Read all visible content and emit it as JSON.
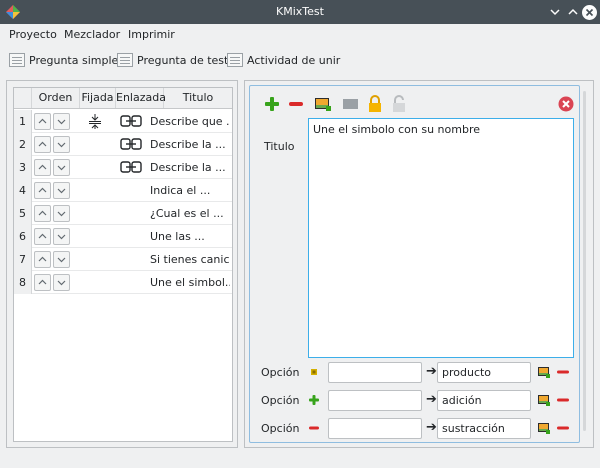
{
  "window": {
    "title": "KMixTest"
  },
  "menu": [
    "Proyecto",
    "Mezclador",
    "Imprimir"
  ],
  "toolbar": [
    {
      "label": "Pregunta simple",
      "icon": "simple-question-icon"
    },
    {
      "label": "Pregunta de test",
      "icon": "test-question-icon"
    },
    {
      "label": "Actividad de unir",
      "icon": "join-activity-icon"
    }
  ],
  "table": {
    "headers": [
      "Orden",
      "Fijada",
      "Enlazada",
      "Titulo"
    ],
    "rows": [
      {
        "num": "1",
        "fixed": true,
        "linked": true,
        "title": "Describe que ..."
      },
      {
        "num": "2",
        "fixed": false,
        "linked": true,
        "title": "Describe la ..."
      },
      {
        "num": "3",
        "fixed": false,
        "linked": true,
        "title": "Describe la ..."
      },
      {
        "num": "4",
        "fixed": false,
        "linked": false,
        "title": "Indica el ..."
      },
      {
        "num": "5",
        "fixed": false,
        "linked": false,
        "title": "¿Cual es el ..."
      },
      {
        "num": "6",
        "fixed": false,
        "linked": false,
        "title": "Une las ..."
      },
      {
        "num": "7",
        "fixed": false,
        "linked": false,
        "title": "Si tienes canic..."
      },
      {
        "num": "8",
        "fixed": false,
        "linked": false,
        "title": "Une el simbol..."
      }
    ]
  },
  "editor": {
    "titulo_label": "Titulo",
    "titulo_text": "Une el simbolo con su nombre",
    "options": [
      {
        "label": "Opción",
        "icon": "star-icon",
        "left": "",
        "right": "producto"
      },
      {
        "label": "Opción",
        "icon": "add-icon",
        "left": "",
        "right": "adición"
      },
      {
        "label": "Opción",
        "icon": "remove-icon",
        "left": "",
        "right": "sustracción"
      }
    ]
  },
  "colors": {
    "accent": "#3daee9",
    "titlebar": "#475057",
    "add": "#37a31b",
    "remove": "#da2a2a"
  }
}
